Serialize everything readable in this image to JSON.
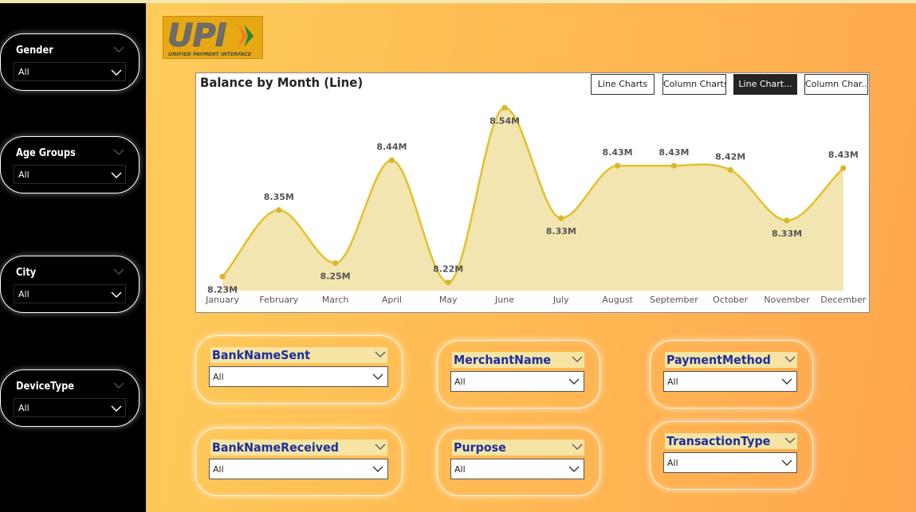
{
  "colors": {
    "line": "#e3c232",
    "area": "#f2e5b0",
    "marker": "#d9b62a",
    "slicer_title_text": "#1a2f9e",
    "slicer_title_bg": "#f6e4a5",
    "sidebar_bg": "#000000"
  },
  "logo": {
    "text": "UPI",
    "subtitle": "UNIFIED PAYMENT INTERFACE"
  },
  "sidebar": {
    "slicers": [
      {
        "title": "Gender",
        "value": "All"
      },
      {
        "title": "Age Groups",
        "value": "All"
      },
      {
        "title": "City",
        "value": "All"
      },
      {
        "title": "DeviceType",
        "value": "All"
      }
    ]
  },
  "chart_tabs": [
    {
      "label": "Line Charts",
      "active": false
    },
    {
      "label": "Column Charts",
      "active": false
    },
    {
      "label": "Line Chart...",
      "active": true
    },
    {
      "label": "Column Char...",
      "active": false
    }
  ],
  "filters": [
    {
      "title": "BankNameSent",
      "value": "All"
    },
    {
      "title": "MerchantName",
      "value": "All"
    },
    {
      "title": "PaymentMethod",
      "value": "All"
    },
    {
      "title": "BankNameReceived",
      "value": "All"
    },
    {
      "title": "Purpose",
      "value": "All"
    },
    {
      "title": "TransactionType",
      "value": "All"
    }
  ],
  "chart_data": {
    "type": "area",
    "title": "Balance by Month (Line)",
    "xlabel": "",
    "ylabel": "",
    "categories": [
      "January",
      "February",
      "March",
      "April",
      "May",
      "June",
      "July",
      "August",
      "September",
      "October",
      "November",
      "December"
    ],
    "series": [
      {
        "values": [
          8.2258,
          8.3487,
          8.2509,
          8.4409,
          8.2152,
          8.5378,
          8.3339,
          8.4307,
          8.4307,
          8.4228,
          8.3296,
          8.4262
        ],
        "labels": [
          "8.23M",
          "8.35M",
          "8.25M",
          "8.44M",
          "8.22M",
          "8.54M",
          "8.33M",
          "8.43M",
          "8.43M",
          "8.42M",
          "8.33M",
          "8.43M"
        ]
      }
    ],
    "label_positions": [
      "below",
      "above",
      "below",
      "above",
      "above",
      "below",
      "below",
      "above",
      "above",
      "above",
      "below",
      "above"
    ],
    "grid": false,
    "legend": "none"
  }
}
